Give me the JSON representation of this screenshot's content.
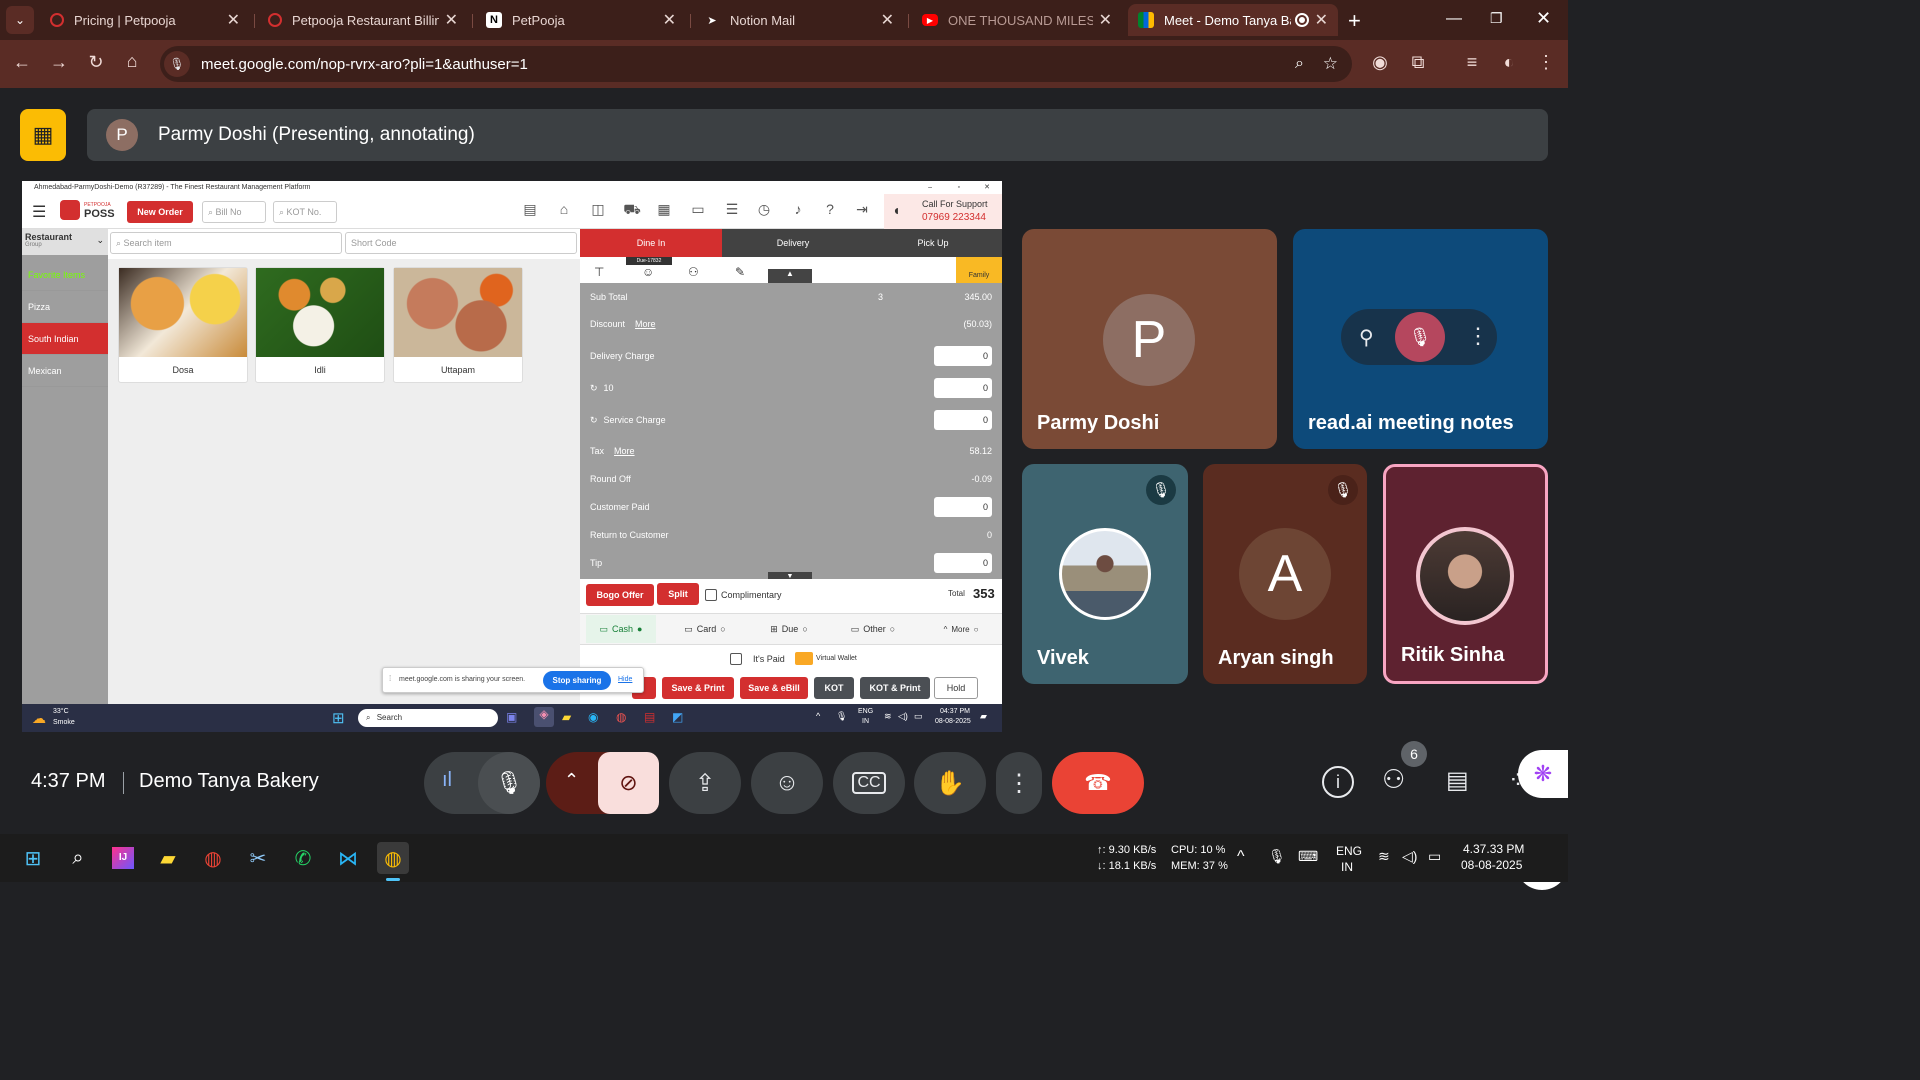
{
  "browser": {
    "tabs": [
      {
        "title": "Pricing | Petpooja",
        "icon": "petpooja-icon"
      },
      {
        "title": "Petpooja Restaurant Billing",
        "icon": "petpooja-icon"
      },
      {
        "title": "PetPooja",
        "icon": "notion-icon"
      },
      {
        "title": "Notion Mail",
        "icon": "notion-mail-icon"
      },
      {
        "title": "ONE THOUSAND MILES (O",
        "icon": "youtube-icon"
      },
      {
        "title": "Meet - Demo Tanya Ba",
        "icon": "google-meet-icon",
        "active": true
      }
    ],
    "new_tab": "+",
    "url": "meet.google.com/nop-rvrx-aro?pli=1&authuser=1"
  },
  "meet": {
    "presenter_initial": "P",
    "presenter_text": "Parmy Doshi (Presenting, annotating)",
    "time": "4:37 PM",
    "meeting_name": "Demo Tanya Bakery",
    "participants_badge": "6",
    "tiles": [
      {
        "name": "Parmy Doshi",
        "initial": "P"
      },
      {
        "name": "read.ai meeting notes"
      },
      {
        "name": "Vivek",
        "muted": true
      },
      {
        "name": "Aryan singh",
        "initial": "A",
        "muted": true
      },
      {
        "name": "Ritik Sinha"
      }
    ]
  },
  "pos": {
    "window_title": "Ahmedabad-ParmyDoshi-Demo (R37289) - The Finest Restaurant Management Platform",
    "logo_small": "PETPOOJA",
    "logo": "POSS",
    "new_order": "New Order",
    "bill_no_placeholder": "Bill No",
    "kot_no_placeholder": "KOT No.",
    "support_title": "Call For Support",
    "support_phone": "07969 223344",
    "restaurant_label": "Restaurant",
    "group_label": "Group",
    "search_placeholder": "Search item",
    "short_code_placeholder": "Short Code",
    "categories": [
      "Favorite Items",
      "Pizza",
      "South Indian",
      "Mexican"
    ],
    "items": [
      "Dosa",
      "Idli",
      "Uttapam"
    ],
    "order_tabs": [
      "Dine In",
      "Delivery",
      "Pick Up"
    ],
    "due_badge": "Due-17832",
    "family_label": "Family",
    "summary": {
      "sub_total_label": "Sub Total",
      "sub_total_qty": "3",
      "sub_total": "345.00",
      "discount_label": "Discount",
      "discount_more": "More",
      "discount": "(50.03)",
      "delivery_label": "Delivery Charge",
      "delivery": "0",
      "ten_label": "10",
      "ten_value": "0",
      "service_label": "Service Charge",
      "service": "0",
      "tax_label": "Tax",
      "tax_more": "More",
      "tax": "58.12",
      "roundoff_label": "Round Off",
      "roundoff": "-0.09",
      "paid_label": "Customer Paid",
      "paid": "0",
      "return_label": "Return to Customer",
      "return": "0",
      "tip_label": "Tip",
      "tip": "0"
    },
    "bogo": "Bogo Offer",
    "split": "Split",
    "complimentary": "Complimentary",
    "total_label": "Total",
    "total": "353",
    "payments": [
      "Cash",
      "Card",
      "Due",
      "Other",
      "More"
    ],
    "its_paid": "It's Paid",
    "virtual_wallet": "Virtual Wallet",
    "sharing_text": "meet.google.com is sharing your screen.",
    "stop_sharing": "Stop sharing",
    "hide": "Hide",
    "actions": [
      "Save & Print",
      "Save & eBill",
      "KOT",
      "KOT & Print",
      "Hold"
    ],
    "weather_temp": "33°C",
    "weather_desc": "Smoke",
    "search": "Search",
    "lang1": "ENG",
    "lang2": "IN",
    "clock_time": "04:37 PM",
    "clock_date": "08-08-2025"
  },
  "taskbar": {
    "net_up": "↑: 9.30 KB/s",
    "net_down": "↓: 18.1 KB/s",
    "cpu": "CPU: 10 %",
    "mem": "MEM: 37 %",
    "lang1": "ENG",
    "lang2": "IN",
    "time": "4.37.33 PM",
    "date": "08-08-2025"
  },
  "colors": {
    "accent_red": "#d32f2f",
    "meet_bg": "#202124",
    "tab_bg": "#3c1f1a",
    "end_call": "#ea4335"
  }
}
